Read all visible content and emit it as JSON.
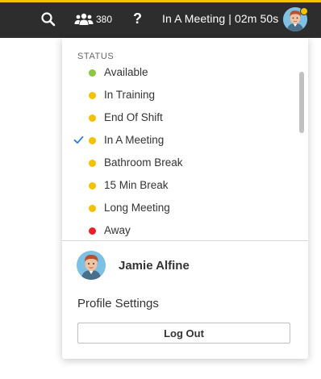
{
  "topbar": {
    "accent_color": "#f2c200",
    "background": "#2d2d2d",
    "search_icon": "search-icon",
    "users_icon": "users-icon",
    "user_count": "380",
    "help_label": "?",
    "current_status": "In A Meeting | 02m 50s",
    "avatar_status_color": "#f2c200"
  },
  "status_menu": {
    "header": "STATUS",
    "items": [
      {
        "label": "Available",
        "color": "#8dc63f",
        "selected": false
      },
      {
        "label": "In Training",
        "color": "#f2c200",
        "selected": false
      },
      {
        "label": "End Of Shift",
        "color": "#f2c200",
        "selected": false
      },
      {
        "label": "In A Meeting",
        "color": "#f2c200",
        "selected": true
      },
      {
        "label": "Bathroom Break",
        "color": "#f2c200",
        "selected": false
      },
      {
        "label": "15 Min Break",
        "color": "#f2c200",
        "selected": false
      },
      {
        "label": "Long Meeting",
        "color": "#f2c200",
        "selected": false
      },
      {
        "label": "Away",
        "color": "#e8202a",
        "selected": false
      }
    ],
    "check_color": "#2b7de9"
  },
  "profile": {
    "name": "Jamie Alfine",
    "settings_label": "Profile Settings",
    "logout_label": "Log Out"
  }
}
